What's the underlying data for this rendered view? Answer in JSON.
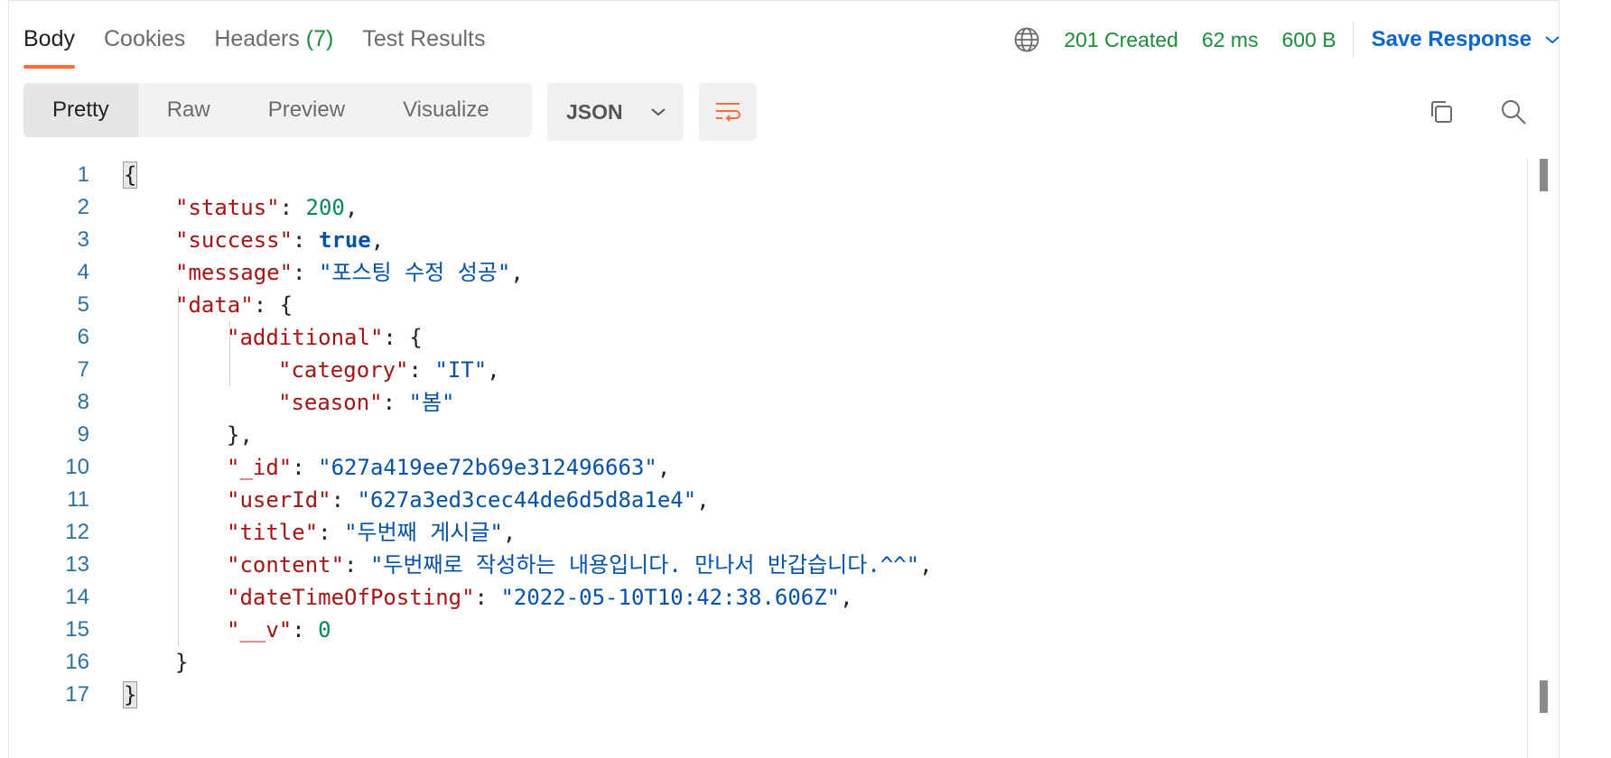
{
  "tabs": [
    {
      "label": "Body",
      "count": ""
    },
    {
      "label": "Cookies",
      "count": ""
    },
    {
      "label": "Headers",
      "count": "(7)"
    },
    {
      "label": "Test Results",
      "count": ""
    }
  ],
  "status": {
    "code": "201 Created",
    "time": "62 ms",
    "size": "600 B",
    "save_label": "Save Response"
  },
  "view_modes": [
    "Pretty",
    "Raw",
    "Preview",
    "Visualize"
  ],
  "format": "JSON",
  "colors": {
    "accent": "#ff6c37",
    "status_green": "#1e8a3c",
    "link_blue": "#0c66c9",
    "json_key": "#a31515",
    "json_string": "#0451a5",
    "json_number": "#098658"
  },
  "icons": [
    "globe-icon",
    "chevron-down-icon",
    "wrap-lines-icon",
    "copy-icon",
    "search-icon"
  ],
  "code_lines": [
    {
      "n": "1",
      "indent": 0,
      "parts": [
        {
          "t": "{",
          "c": "p hl"
        }
      ]
    },
    {
      "n": "2",
      "indent": 1,
      "parts": [
        {
          "t": "\"status\"",
          "c": "k"
        },
        {
          "t": ": ",
          "c": "p"
        },
        {
          "t": "200",
          "c": "n"
        },
        {
          "t": ",",
          "c": "p"
        }
      ]
    },
    {
      "n": "3",
      "indent": 1,
      "parts": [
        {
          "t": "\"success\"",
          "c": "k"
        },
        {
          "t": ": ",
          "c": "p"
        },
        {
          "t": "true",
          "c": "b"
        },
        {
          "t": ",",
          "c": "p"
        }
      ]
    },
    {
      "n": "4",
      "indent": 1,
      "parts": [
        {
          "t": "\"message\"",
          "c": "k"
        },
        {
          "t": ": ",
          "c": "p"
        },
        {
          "t": "\"포스팅 수정 성공\"",
          "c": "s"
        },
        {
          "t": ",",
          "c": "p"
        }
      ]
    },
    {
      "n": "5",
      "indent": 1,
      "parts": [
        {
          "t": "\"data\"",
          "c": "k"
        },
        {
          "t": ": {",
          "c": "p"
        }
      ]
    },
    {
      "n": "6",
      "indent": 2,
      "parts": [
        {
          "t": "\"additional\"",
          "c": "k"
        },
        {
          "t": ": {",
          "c": "p"
        }
      ]
    },
    {
      "n": "7",
      "indent": 3,
      "parts": [
        {
          "t": "\"category\"",
          "c": "k"
        },
        {
          "t": ": ",
          "c": "p"
        },
        {
          "t": "\"IT\"",
          "c": "s"
        },
        {
          "t": ",",
          "c": "p"
        }
      ]
    },
    {
      "n": "8",
      "indent": 3,
      "parts": [
        {
          "t": "\"season\"",
          "c": "k"
        },
        {
          "t": ": ",
          "c": "p"
        },
        {
          "t": "\"봄\"",
          "c": "s"
        }
      ]
    },
    {
      "n": "9",
      "indent": 2,
      "parts": [
        {
          "t": "},",
          "c": "p"
        }
      ]
    },
    {
      "n": "10",
      "indent": 2,
      "parts": [
        {
          "t": "\"_id\"",
          "c": "k"
        },
        {
          "t": ": ",
          "c": "p"
        },
        {
          "t": "\"627a419ee72b69e312496663\"",
          "c": "s"
        },
        {
          "t": ",",
          "c": "p"
        }
      ]
    },
    {
      "n": "11",
      "indent": 2,
      "parts": [
        {
          "t": "\"userId\"",
          "c": "k"
        },
        {
          "t": ": ",
          "c": "p"
        },
        {
          "t": "\"627a3ed3cec44de6d5d8a1e4\"",
          "c": "s"
        },
        {
          "t": ",",
          "c": "p"
        }
      ]
    },
    {
      "n": "12",
      "indent": 2,
      "parts": [
        {
          "t": "\"title\"",
          "c": "k"
        },
        {
          "t": ": ",
          "c": "p"
        },
        {
          "t": "\"두번째 게시글\"",
          "c": "s"
        },
        {
          "t": ",",
          "c": "p"
        }
      ]
    },
    {
      "n": "13",
      "indent": 2,
      "parts": [
        {
          "t": "\"content\"",
          "c": "k"
        },
        {
          "t": ": ",
          "c": "p"
        },
        {
          "t": "\"두번째로 작성하는 내용입니다. 만나서 반갑습니다.^^\"",
          "c": "s"
        },
        {
          "t": ",",
          "c": "p"
        }
      ]
    },
    {
      "n": "14",
      "indent": 2,
      "parts": [
        {
          "t": "\"dateTimeOfPosting\"",
          "c": "k"
        },
        {
          "t": ": ",
          "c": "p"
        },
        {
          "t": "\"2022-05-10T10:42:38.606Z\"",
          "c": "s"
        },
        {
          "t": ",",
          "c": "p"
        }
      ]
    },
    {
      "n": "15",
      "indent": 2,
      "parts": [
        {
          "t": "\"__v\"",
          "c": "k"
        },
        {
          "t": ": ",
          "c": "p"
        },
        {
          "t": "0",
          "c": "n"
        }
      ]
    },
    {
      "n": "16",
      "indent": 1,
      "parts": [
        {
          "t": "}",
          "c": "p"
        }
      ]
    },
    {
      "n": "17",
      "indent": 0,
      "parts": [
        {
          "t": "}",
          "c": "p hl"
        }
      ]
    }
  ]
}
